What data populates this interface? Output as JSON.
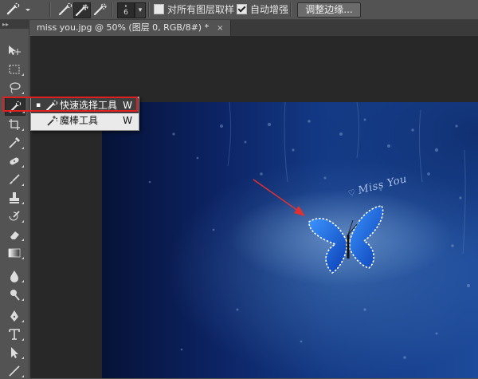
{
  "options_bar": {
    "brush_size": "6",
    "sample_all_layers_label": "对所有图层取样",
    "sample_all_layers_checked": false,
    "auto_enhance_label": "自动增强",
    "auto_enhance_checked": true,
    "refine_edge_label": "调整边缘..."
  },
  "document_tab": {
    "title": "miss you.jpg @ 50% (图层 0, RGB/8#) *",
    "close_glyph": "×"
  },
  "toolbar": {
    "collapse_glyph": "▸▸",
    "tools": [
      "move-tool",
      "marquee-tool",
      "lasso-tool",
      "quick-selection-tool",
      "crop-tool",
      "eyedropper-tool",
      "healing-brush-tool",
      "brush-tool",
      "clone-stamp-tool",
      "history-brush-tool",
      "eraser-tool",
      "gradient-tool",
      "blur-tool",
      "dodge-tool",
      "pen-tool",
      "type-tool",
      "path-selection-tool",
      "line-tool"
    ]
  },
  "flyout": {
    "items": [
      {
        "label": "快速选择工具",
        "shortcut": "W",
        "active": true,
        "marker": "▪"
      },
      {
        "label": "魔棒工具",
        "shortcut": "W",
        "active": false,
        "marker": ""
      }
    ]
  },
  "canvas": {
    "photo_text": "Miss You"
  },
  "colors": {
    "highlight": "#e02020",
    "arrow": "#e03030",
    "ui_panel": "#535353",
    "canvas_bg": "#282828",
    "butterfly": "#1e6ee6"
  }
}
